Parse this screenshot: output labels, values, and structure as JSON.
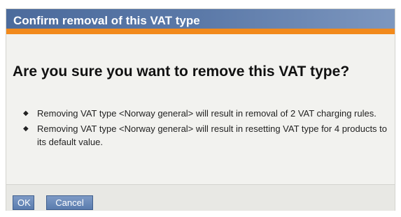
{
  "dialog": {
    "title": "Confirm removal of this VAT type",
    "heading": "Are you sure you want to remove this VAT type?",
    "items": [
      "Removing VAT type <Norway general> will result in removal of 2 VAT charging rules.",
      "Removing VAT type <Norway general> will result in resetting VAT type for 4 products to its default value."
    ],
    "bullet": "◆",
    "buttons": {
      "ok": "OK",
      "cancel": "Cancel"
    }
  },
  "colors": {
    "titlebar": "#5b79a8",
    "accent_stripe": "#f28a1c",
    "button": "#6a8bbb",
    "background": "#f2f2ef"
  }
}
